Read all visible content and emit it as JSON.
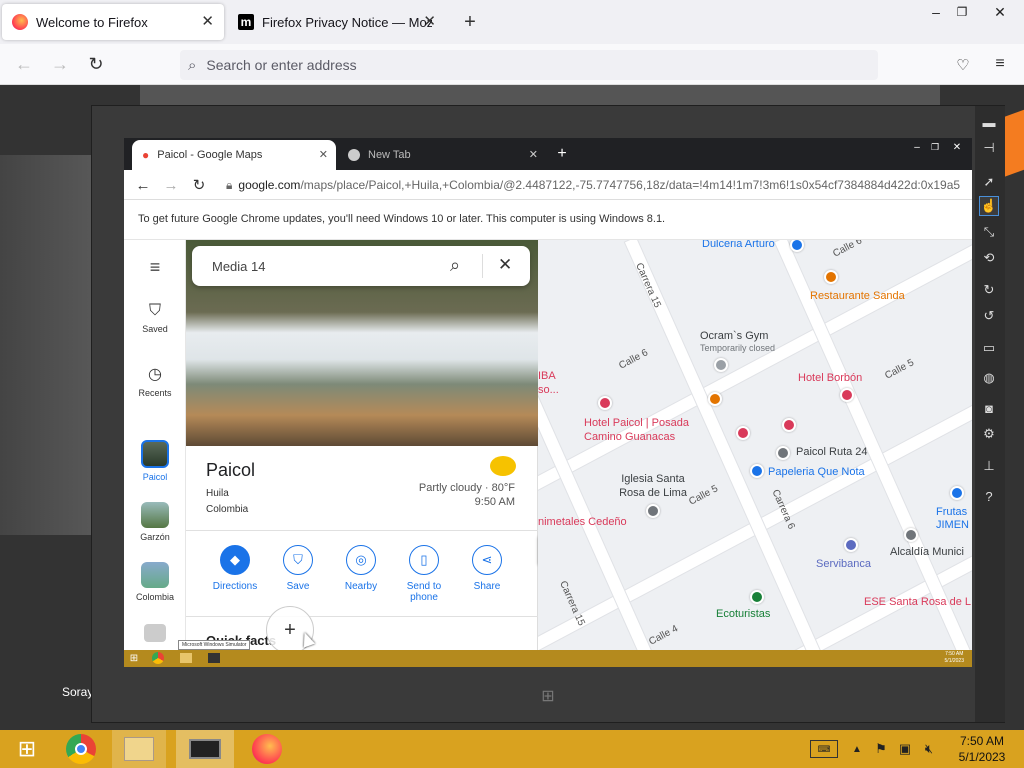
{
  "firefox": {
    "tabs": [
      {
        "title": "Welcome to Firefox"
      },
      {
        "title": "Firefox Privacy Notice — Mozilla"
      }
    ],
    "address_placeholder": "Search or enter address",
    "background_text": {
      "caption": "Soray"
    }
  },
  "chrome": {
    "tabs": [
      {
        "title": "Paicol - Google Maps"
      },
      {
        "title": "New Tab"
      }
    ],
    "url_host": "google.com",
    "url_path": "/maps/place/Paicol,+Huila,+Colombia/@2.4487122,-75.7747756,18z/data=!4m14!1m7!3m6!1s0x54cf7384884d422d:0x19a5",
    "update_notice": "To get future Google Chrome updates, you'll need Windows 10 or later. This computer is using Windows 8.1."
  },
  "maps": {
    "rail": [
      {
        "label": "Saved"
      },
      {
        "label": "Recents"
      },
      {
        "label": "Paicol"
      },
      {
        "label": "Garzón"
      },
      {
        "label": "Colombia"
      }
    ],
    "search_value": "Media 14",
    "place": {
      "name": "Paicol",
      "region": "Huila",
      "country": "Colombia",
      "weather": "Partly cloudy · 80°F",
      "time": "9:50 AM"
    },
    "actions": [
      {
        "label": "Directions"
      },
      {
        "label": "Save"
      },
      {
        "label": "Nearby"
      },
      {
        "label": "Send to phone"
      },
      {
        "label": "Share"
      }
    ],
    "quick_facts": "Quick facts",
    "places": [
      "Dulceria Arturo",
      "Restaurante Sanda",
      "Ocram`s Gym",
      "Temporarily closed",
      "Hotel Borbón",
      "Hotel Paicol | Posada Camino Guanacas",
      "Paicol Ruta 24",
      "Papeleria Que Nota",
      "Iglesia Santa Rosa de Lima",
      "nimetales Cedeño",
      "Servibanca",
      "Alcaldía Munici",
      "Ecoturistas",
      "ESE Santa Rosa de L",
      "Frutas JIMEN",
      "IBA",
      "so..."
    ],
    "streets": [
      "Calle 6",
      "Calle 6",
      "Calle 5",
      "Calle 5",
      "Carrera 6",
      "Carrera 6",
      "Carrera 15",
      "Calle 4"
    ],
    "colors": {
      "blue": "#1a73e8",
      "red": "#d93a5a",
      "orange": "#e37400",
      "green": "#188038"
    }
  },
  "simulator": {
    "tooltip": "Microsoft Windows Simulator",
    "clock_time": "7:50 AM",
    "clock_date": "5/1/2023"
  },
  "taskbar": {
    "time": "7:50 AM",
    "date": "5/1/2023"
  }
}
